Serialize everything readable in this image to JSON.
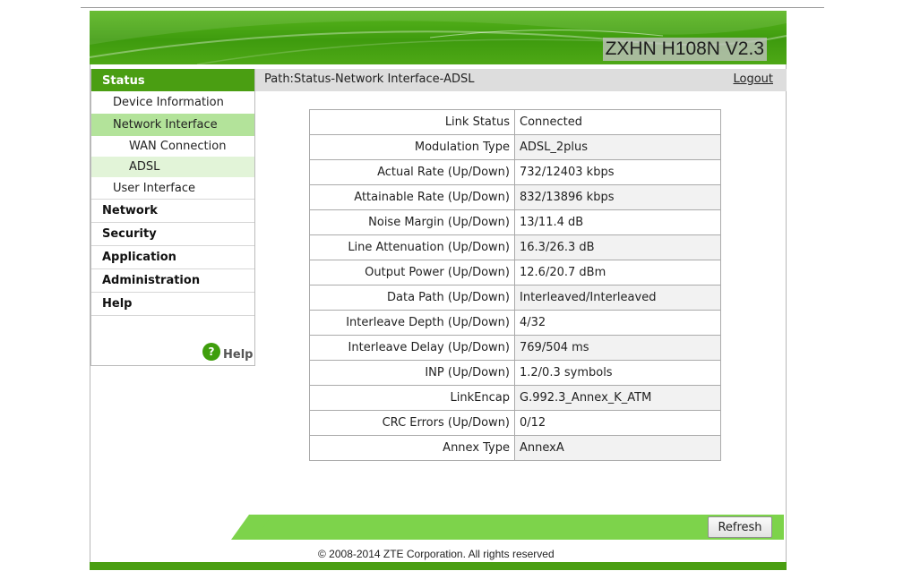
{
  "banner": {
    "product_name": "ZXHN H108N V2.3"
  },
  "sidebar": {
    "status": "Status",
    "device_information": "Device Information",
    "network_interface": "Network Interface",
    "wan_connection": "WAN Connection",
    "adsl": "ADSL",
    "user_interface": "User Interface",
    "network": "Network",
    "security": "Security",
    "application": "Application",
    "administration": "Administration",
    "help": "Help",
    "help_link": "Help",
    "help_icon_glyph": "?"
  },
  "pathbar": {
    "path": "Path:Status-Network Interface-ADSL",
    "logout": "Logout"
  },
  "adsl_info": {
    "rows": [
      {
        "label": "Link Status",
        "value": "Connected"
      },
      {
        "label": "Modulation Type",
        "value": "ADSL_2plus"
      },
      {
        "label": "Actual Rate (Up/Down)",
        "value": "732/12403 kbps"
      },
      {
        "label": "Attainable Rate (Up/Down)",
        "value": "832/13896 kbps"
      },
      {
        "label": "Noise Margin (Up/Down)",
        "value": "13/11.4 dB"
      },
      {
        "label": "Line Attenuation (Up/Down)",
        "value": "16.3/26.3 dB"
      },
      {
        "label": "Output Power (Up/Down)",
        "value": "12.6/20.7 dBm"
      },
      {
        "label": "Data Path (Up/Down)",
        "value": "Interleaved/Interleaved"
      },
      {
        "label": "Interleave Depth (Up/Down)",
        "value": "4/32"
      },
      {
        "label": "Interleave Delay (Up/Down)",
        "value": "769/504 ms"
      },
      {
        "label": "INP (Up/Down)",
        "value": "1.2/0.3 symbols"
      },
      {
        "label": "LinkEncap",
        "value": "G.992.3_Annex_K_ATM"
      },
      {
        "label": "CRC Errors (Up/Down)",
        "value": "0/12"
      },
      {
        "label": "Annex Type",
        "value": "AnnexA"
      }
    ]
  },
  "footer": {
    "refresh": "Refresh",
    "copyright": "© 2008-2014 ZTE Corporation. All rights reserved"
  },
  "colors": {
    "brand_green": "#4a9e12",
    "bar_green": "#7dd34b",
    "active_nav": "#b3e39a",
    "active_subnav": "#e2f4d8",
    "pathbar_gray": "#dddddd"
  }
}
